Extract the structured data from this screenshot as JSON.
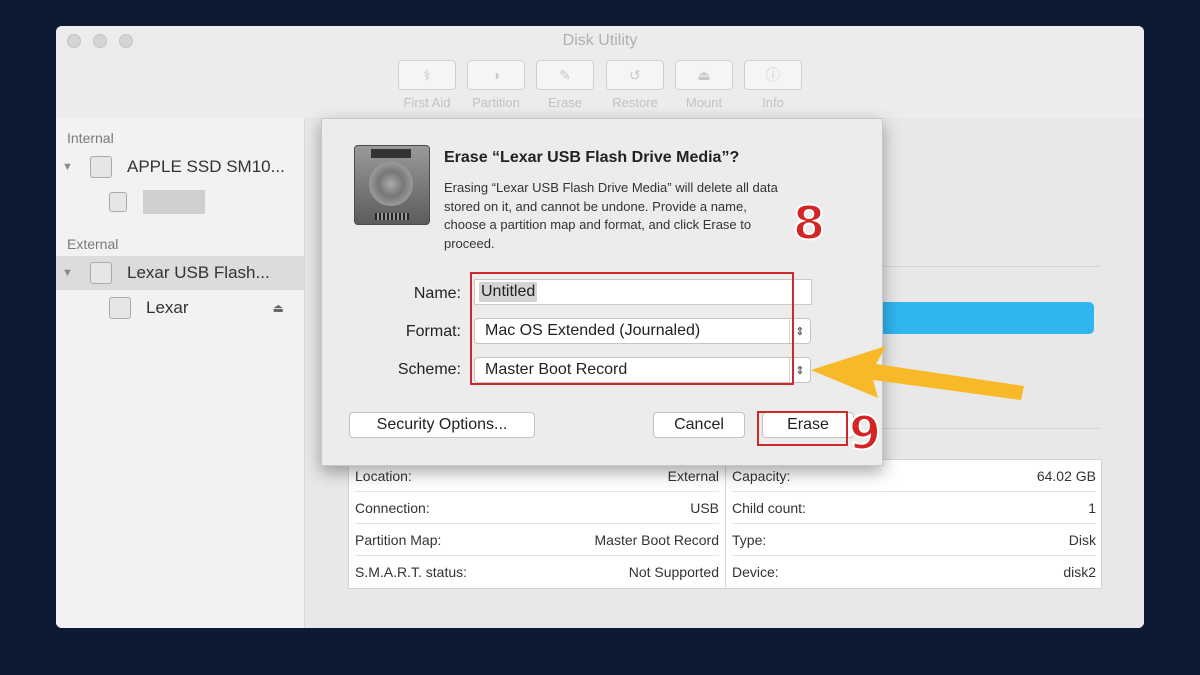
{
  "window": {
    "title": "Disk Utility",
    "toolbar": [
      {
        "label": "First Aid",
        "icon": "stethoscope-icon"
      },
      {
        "label": "Partition",
        "icon": "partition-pie-icon"
      },
      {
        "label": "Erase",
        "icon": "erase-disk-icon"
      },
      {
        "label": "Restore",
        "icon": "restore-arrow-icon"
      },
      {
        "label": "Mount",
        "icon": "mount-icon"
      },
      {
        "label": "Info",
        "icon": "info-icon"
      }
    ]
  },
  "sidebar": {
    "internal_header": "Internal",
    "internal_disk": "APPLE SSD SM10...",
    "external_header": "External",
    "external_disk": "Lexar USB Flash...",
    "external_volume": "Lexar"
  },
  "dialog": {
    "title": "Erase “Lexar USB Flash Drive Media”?",
    "description_lines": [
      "Erasing “Lexar USB Flash Drive Media” will delete all data",
      "stored on it, and cannot be undone. Provide a name,",
      "choose a partition map and format, and click Erase to",
      "proceed."
    ],
    "name_label": "Name:",
    "name_value": "Untitled",
    "format_label": "Format:",
    "format_value": "Mac OS Extended (Journaled)",
    "scheme_label": "Scheme:",
    "scheme_value": "Master Boot Record",
    "security_button": "Security Options...",
    "cancel_button": "Cancel",
    "erase_button": "Erase"
  },
  "annotations": {
    "step_8": "8",
    "step_9": "9",
    "highlight_color": "#cc2a2a",
    "arrow_color": "#f7b928"
  },
  "info": {
    "left": [
      {
        "label": "Location:",
        "value": "External"
      },
      {
        "label": "Connection:",
        "value": "USB"
      },
      {
        "label": "Partition Map:",
        "value": "Master Boot Record"
      },
      {
        "label": "S.M.A.R.T. status:",
        "value": "Not Supported"
      }
    ],
    "right": [
      {
        "label": "Capacity:",
        "value": "64.02 GB"
      },
      {
        "label": "Child count:",
        "value": "1"
      },
      {
        "label": "Type:",
        "value": "Disk"
      },
      {
        "label": "Device:",
        "value": "disk2"
      }
    ]
  },
  "colors": {
    "background": "#0d1a33",
    "selection_blue": "#2fb6f0"
  }
}
